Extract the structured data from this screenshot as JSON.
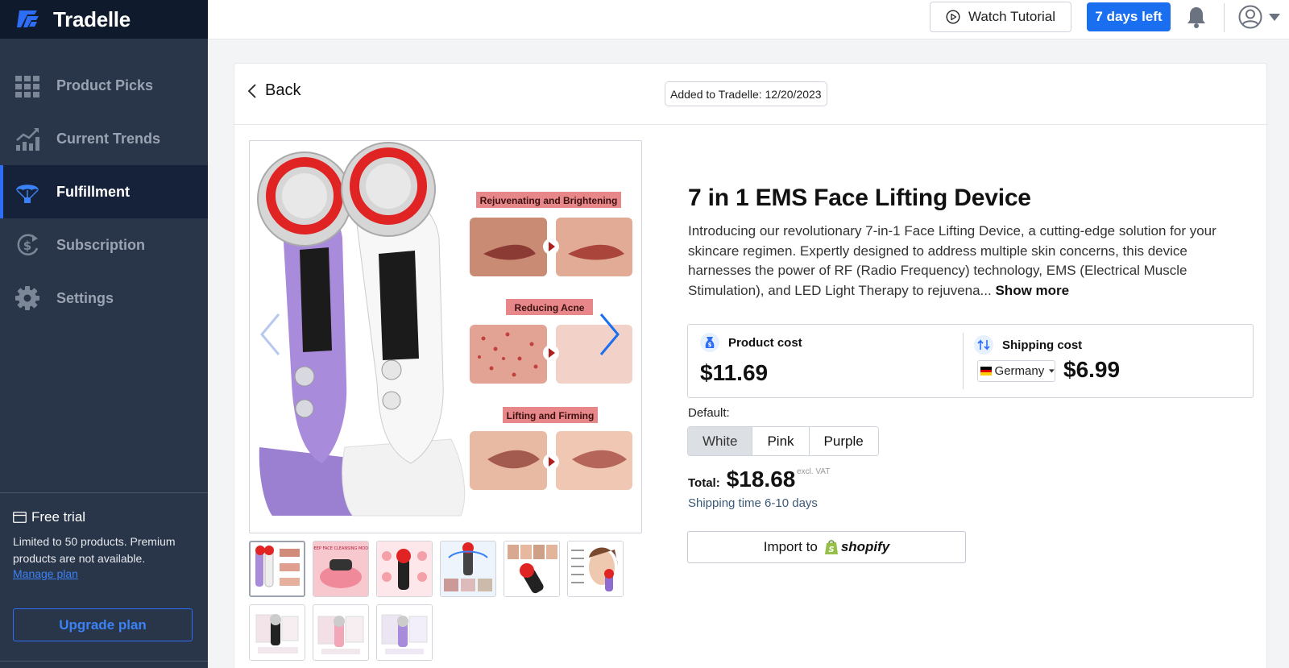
{
  "app": {
    "name": "Tradelle"
  },
  "sidebar": {
    "items": [
      {
        "label": "Product Picks",
        "icon": "grid-icon",
        "active": false
      },
      {
        "label": "Current Trends",
        "icon": "trend-chart-icon",
        "active": false
      },
      {
        "label": "Fulfillment",
        "icon": "parachute-icon",
        "active": true
      },
      {
        "label": "Subscription",
        "icon": "dollar-cycle-icon",
        "active": false
      },
      {
        "label": "Settings",
        "icon": "gear-icon",
        "active": false
      }
    ],
    "trial": {
      "title": "Free trial",
      "text": "Limited to 50 products. Premium products are not available.",
      "manage_link": "Manage plan",
      "upgrade_button": "Upgrade plan"
    }
  },
  "topbar": {
    "watch_tutorial": "Watch Tutorial",
    "days_left": "7 days left"
  },
  "page": {
    "back_label": "Back",
    "added_badge": "Added to Tradelle: 12/20/2023",
    "product": {
      "title": "7 in 1 EMS Face Lifting Device",
      "description": "Introducing our revolutionary 7-in-1 Face Lifting Device, a cutting-edge solution for your skincare regimen. Expertly designed to address multiple skin concerns, this device harnesses the power of RF (Radio Frequency) technology, EMS (Electrical Muscle Stimulation), and LED Light Therapy to rejuvena...",
      "show_more": "Show more",
      "image_captions": [
        "Rejuvenating and Brightening",
        "Reducing Acne",
        "Lifting and Firming"
      ]
    },
    "costs": {
      "product_cost_label": "Product cost",
      "product_cost": "$11.69",
      "shipping_cost_label": "Shipping cost",
      "country": "Germany",
      "shipping_cost": "$6.99"
    },
    "variants": {
      "label": "Default:",
      "options": [
        "White",
        "Pink",
        "Purple"
      ],
      "selected": "White"
    },
    "total": {
      "label": "Total:",
      "value": "$18.68",
      "vat_note": "excl. VAT",
      "shipping_time": "Shipping time 6-10 days"
    },
    "import": {
      "label": "Import to",
      "platform": "shopify"
    }
  },
  "colors": {
    "sidebar_bg": "#293548",
    "brand_bg": "#0f1b2d",
    "accent": "#1a6ef0",
    "active_nav_bg": "#15223a"
  }
}
